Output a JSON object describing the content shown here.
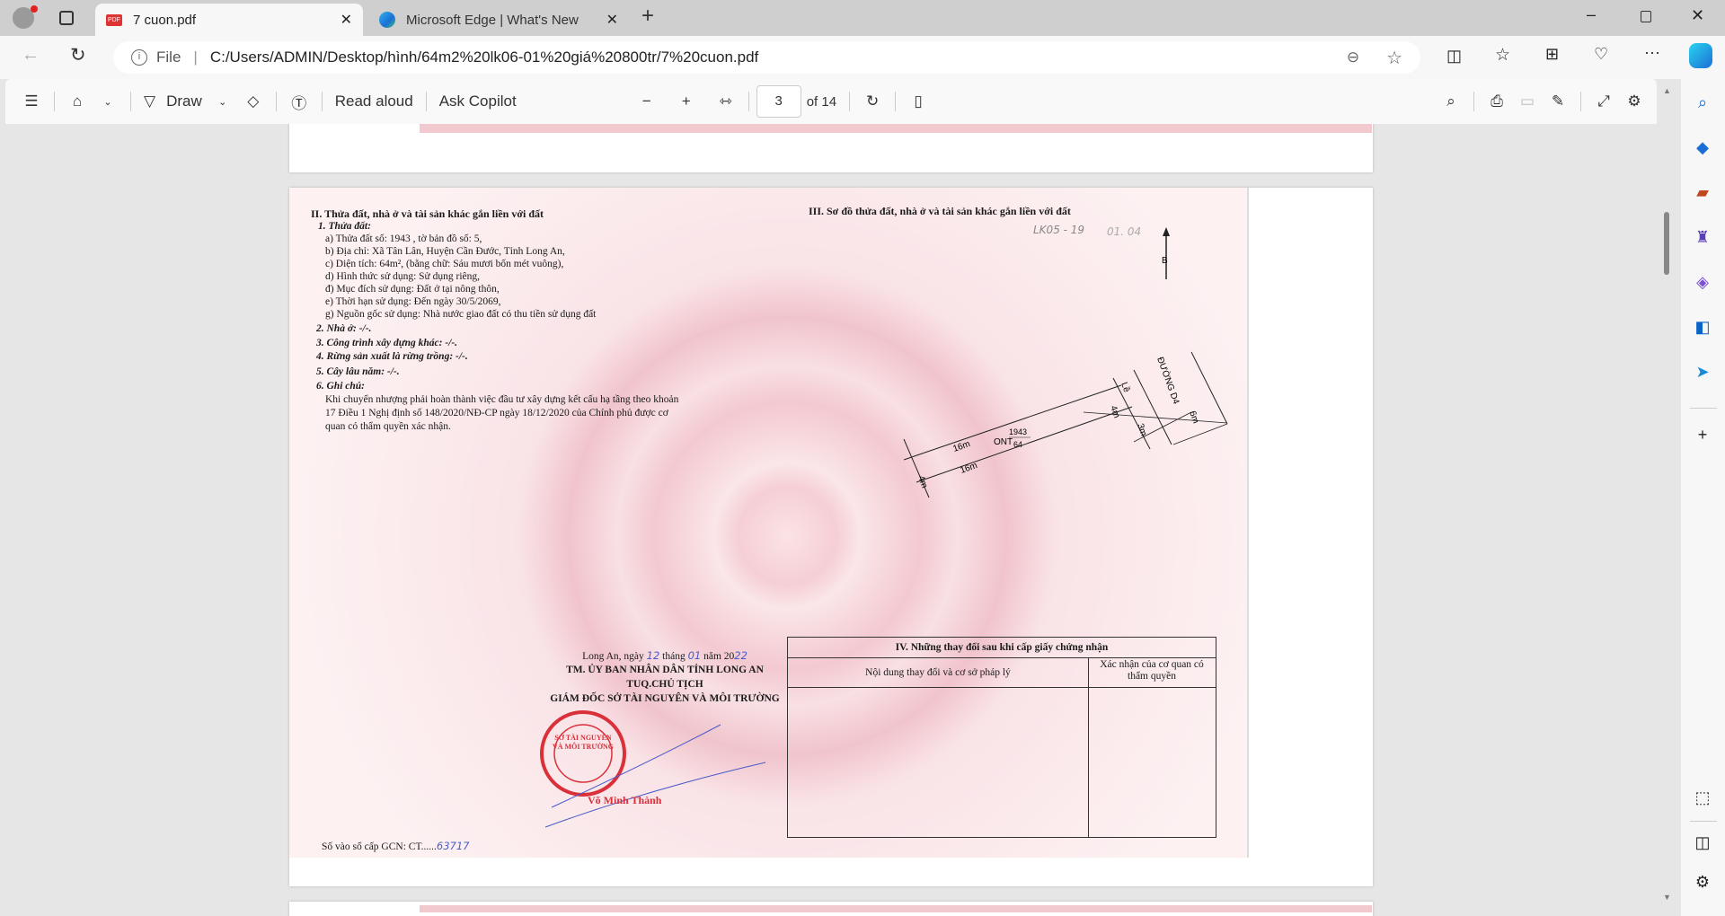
{
  "browser": {
    "tabs": [
      {
        "title": "7 cuon.pdf",
        "icon": "pdf-icon",
        "active": true
      },
      {
        "title": "Microsoft Edge | What's New",
        "icon": "edge-icon",
        "active": false
      }
    ],
    "address": {
      "scheme_label": "File",
      "url": "C:/Users/ADMIN/Desktop/hình/64m2%20lk06-01%20giá%20800tr/7%20cuon.pdf"
    }
  },
  "pdf_toolbar": {
    "draw_label": "Draw",
    "read_aloud": "Read aloud",
    "ask_copilot": "Ask Copilot",
    "page_current": "3",
    "page_total": "of 14"
  },
  "document": {
    "section2": {
      "title": "II. Thửa đất, nhà ở và tài sản khác gắn liền với đất",
      "sub1": "1. Thửa đất:",
      "lines": [
        "a) Thửa đất số:      1943         , tờ bản đồ số:            5,",
        "b) Địa chỉ:  Xã Tân Lân, Huyện Cần Đước, Tỉnh Long An,",
        "c) Diện tích:          64m², (bằng chữ: Sáu mươi bốn mét vuông),",
        "d) Hình thức sử dụng:   Sử dụng riêng,",
        "đ) Mục đích sử dụng:  Đất ở tại nông thôn,",
        "e) Thời hạn sử dụng:  Đến ngày 30/5/2069,",
        "g) Nguồn gốc sử dụng: Nhà nước giao đất có thu tiền sử dụng đất"
      ],
      "items": [
        "2. Nhà ở:  -/-.",
        "3. Công trình xây dựng khác: -/-.",
        "4. Rừng sản xuất là rừng trồng: -/-.",
        "5. Cây lâu năm:  -/-.",
        "6. Ghi chú:"
      ],
      "note": [
        "Khi chuyển nhượng phải hoàn thành việc đầu tư xây dựng kết cấu hạ tầng theo khoản",
        "17 Điều 1 Nghị định số 148/2020/NĐ-CP ngày 18/12/2020 của Chính phủ được cơ",
        "quan có thẩm quyền xác nhận."
      ]
    },
    "section3": {
      "title": "III. Sơ đồ thửa đất, nhà ở và tài sản khác gắn liền với đất",
      "handwritten": "LK05 - 19",
      "handwritten2": "01. 04",
      "north": "B",
      "labels": {
        "road": "ĐƯỜNG D4",
        "road_width": "6m",
        "le": "Lề",
        "le_width": "3m",
        "width_top": "4m",
        "width_bottom": "4m",
        "len_top": "16m",
        "len_bottom": "16m",
        "use": "ONT",
        "parcel": "1943",
        "area": "64"
      }
    },
    "signature": {
      "date_prefix": "Long An, ngày",
      "day": "12",
      "month_label": "tháng",
      "month": "01",
      "year_label": "năm 20",
      "year": "22",
      "org": "TM. ỦY BAN NHÂN DÂN TỈNH LONG AN",
      "role": "TUQ.CHỦ TỊCH",
      "title": "GIÁM ĐỐC SỞ TÀI NGUYÊN VÀ MÔI TRƯỜNG",
      "stamp": "SỞ TÀI NGUYÊN VÀ MÔI TRƯỜNG",
      "name": "Võ Minh Thành"
    },
    "section4": {
      "title": "IV. Những thay đổi sau khi cấp giấy chứng nhận",
      "col1": "Nội dung thay đổi và cơ sở pháp lý",
      "col2": "Xác nhận của cơ quan có thẩm quyền"
    },
    "registry": {
      "label": "Số vào sổ cấp GCN: CT......",
      "number": "63717"
    }
  },
  "colors": {
    "tabbar": "#cfcfcf",
    "stamp": "#d9303a",
    "page_tint": "#f5cfd5",
    "ink": "#4a5bc7"
  }
}
